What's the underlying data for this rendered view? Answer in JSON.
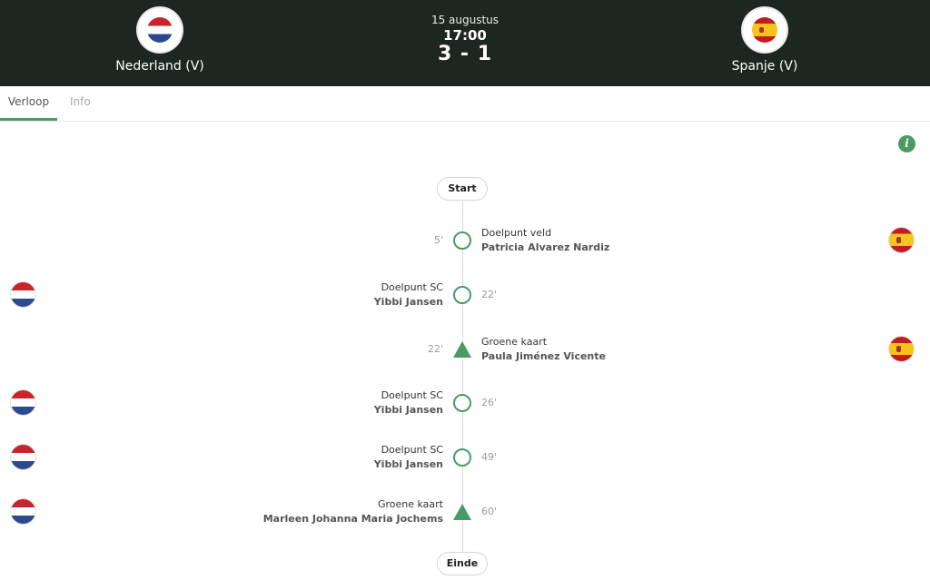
{
  "match": {
    "date": "15 augustus",
    "time": "17:00",
    "score": "3 - 1",
    "home": {
      "name": "Nederland (V)",
      "flag": "netherlands-flag"
    },
    "away": {
      "name": "Spanje (V)",
      "flag": "spain-flag"
    }
  },
  "tabs": [
    {
      "label": "Verloop",
      "active": true
    },
    {
      "label": "Info",
      "active": false
    }
  ],
  "timeline": {
    "start_label": "Start",
    "end_label": "Einde",
    "events": [
      {
        "minute": "5'",
        "type": "Doelpunt veld",
        "player": "Patricia Alvarez Nardiz",
        "team": "away",
        "marker": "circle"
      },
      {
        "minute": "22'",
        "type": "Doelpunt SC",
        "player": "Yibbi Jansen",
        "team": "home",
        "marker": "circle"
      },
      {
        "minute": "22'",
        "type": "Groene kaart",
        "player": "Paula Jiménez Vicente",
        "team": "away",
        "marker": "triangle"
      },
      {
        "minute": "26'",
        "type": "Doelpunt SC",
        "player": "Yibbi Jansen",
        "team": "home",
        "marker": "circle"
      },
      {
        "minute": "49'",
        "type": "Doelpunt SC",
        "player": "Yibbi Jansen",
        "team": "home",
        "marker": "circle"
      },
      {
        "minute": "60'",
        "type": "Groene kaart",
        "player": "Marleen Johanna Maria Jochems",
        "team": "home",
        "marker": "triangle"
      }
    ]
  },
  "colors": {
    "header_bg": "#1e2621",
    "accent": "#4a9b63"
  }
}
